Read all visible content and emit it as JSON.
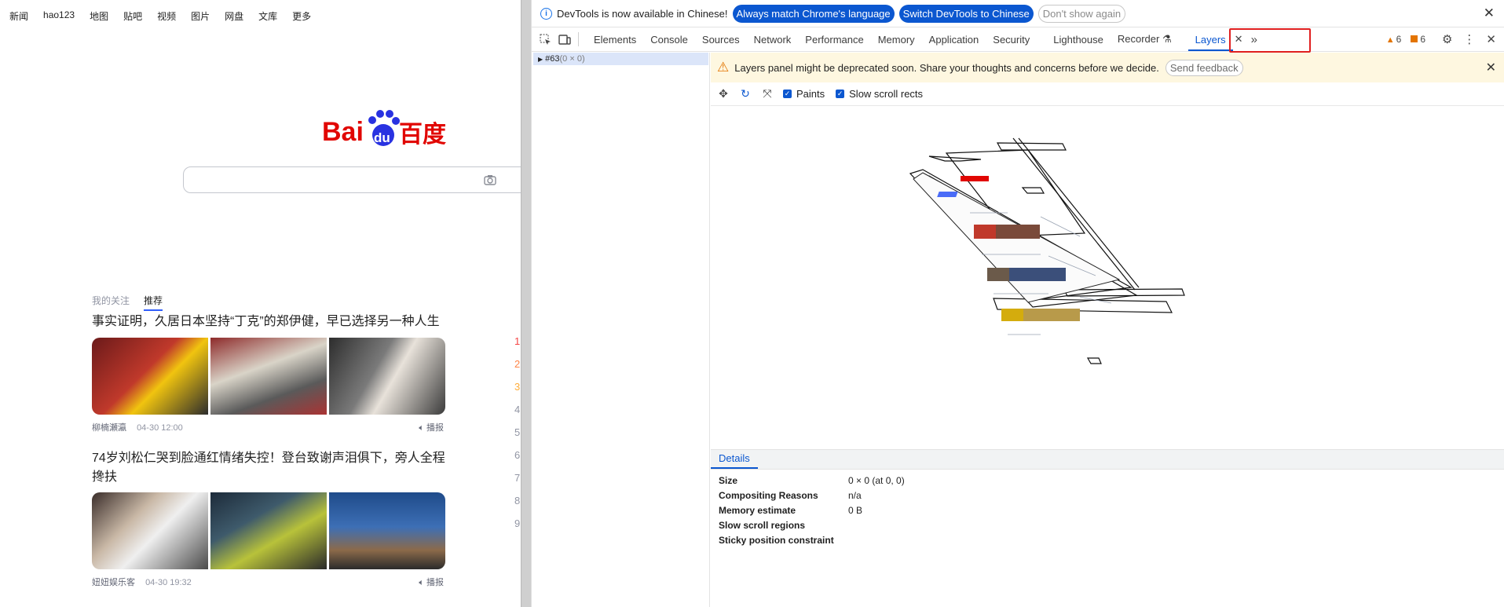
{
  "page": {
    "topnav": [
      "新闻",
      "hao123",
      "地图",
      "贴吧",
      "视频",
      "图片",
      "网盘",
      "文库",
      "更多"
    ],
    "logo": {
      "bai": "Bai",
      "du": "du",
      "cn": "百度"
    },
    "feed_tabs": [
      "我的关注",
      "推荐"
    ],
    "news": [
      {
        "title": "事实证明，久居日本坚持“丁克”的郑伊健，早已选择另一种人生",
        "source": "柳楠瀬瀛",
        "time": "04-30 12:00",
        "play": "播报"
      },
      {
        "title": "74岁刘松仁哭到脸通红情绪失控！登台致谢声泪俱下，旁人全程搀扶",
        "source": "妞妞娱乐客",
        "time": "04-30 19:32",
        "play": "播报"
      }
    ],
    "rank_numbers": [
      "1",
      "2",
      "3",
      "4",
      "5",
      "6",
      "7",
      "8",
      "9"
    ]
  },
  "devtools": {
    "infobar": {
      "message": "DevTools is now available in Chinese!",
      "btn_match": "Always match Chrome's language",
      "btn_switch": "Switch DevTools to Chinese",
      "btn_dismiss": "Don't show again"
    },
    "tabs": [
      "Elements",
      "Console",
      "Sources",
      "Network",
      "Performance",
      "Memory",
      "Application",
      "Security",
      "Lighthouse",
      "Recorder"
    ],
    "active_tab": "Layers",
    "warnings_count": "6",
    "errors_count": "6",
    "tree": {
      "node": "#63",
      "dims": "(0 × 0)"
    },
    "warning": {
      "message": "Layers panel might be deprecated soon. Share your thoughts and concerns before we decide.",
      "feedback": "Send feedback"
    },
    "toolbar": {
      "paints": "Paints",
      "slow_scroll": "Slow scroll rects"
    },
    "details": {
      "tab": "Details",
      "rows": [
        {
          "key": "Size",
          "value": "0 × 0 (at 0, 0)"
        },
        {
          "key": "Compositing Reasons",
          "value": "n/a"
        },
        {
          "key": "Memory estimate",
          "value": "0 B"
        },
        {
          "key": "Slow scroll regions",
          "value": ""
        },
        {
          "key": "Sticky position constraint",
          "value": ""
        }
      ]
    }
  },
  "colors": {
    "accent": "#0b57d0",
    "warning_bg": "#fef7e0",
    "highlight": "#e02020",
    "baidu_red": "#e10602",
    "baidu_blue": "#2932e1"
  }
}
